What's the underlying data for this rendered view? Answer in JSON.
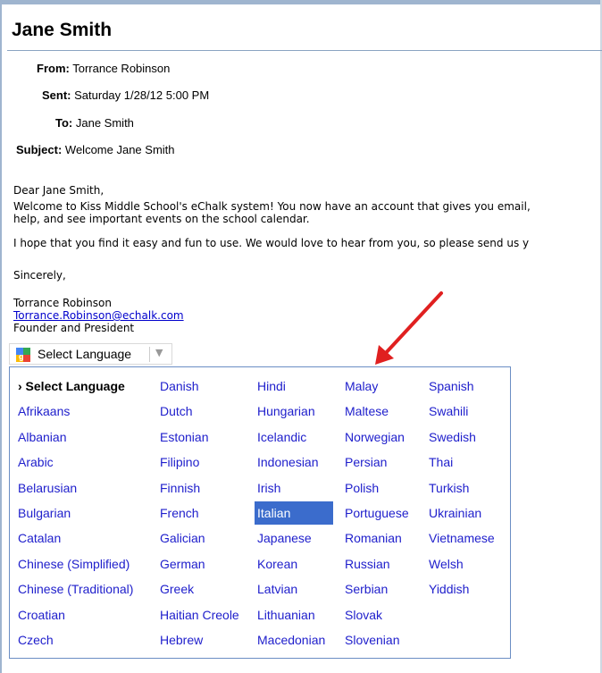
{
  "email": {
    "title": "Jane Smith",
    "from_label": "From:",
    "from_value": "Torrance Robinson",
    "sent_label": "Sent:",
    "sent_value": "Saturday 1/28/12 5:00 PM",
    "to_label": "To:",
    "to_value": "Jane Smith",
    "subject_label": "Subject:",
    "subject_value": "Welcome Jane Smith",
    "greeting": "Dear Jane Smith,",
    "para1_line1": "Welcome to Kiss Middle School's eChalk system! You now have an account that gives you email,",
    "para1_line2": "help, and see important events on the school calendar.",
    "para2": "I hope that you find it easy and fun to use. We would love to hear from you, so please send us y",
    "closing": "Sincerely,",
    "sig_name": "Torrance Robinson",
    "sig_email": "Torrance.Robinson@echalk.com",
    "sig_title": "Founder and President"
  },
  "translate": {
    "button_label": "Select Language",
    "arrow_glyph": "▼",
    "languages": [
      [
        "› Select Language",
        "Afrikaans",
        "Albanian",
        "Arabic",
        "Belarusian",
        "Bulgarian",
        "Catalan",
        "Chinese (Simplified)",
        "Chinese (Traditional)",
        "Croatian",
        "Czech"
      ],
      [
        "Danish",
        "Dutch",
        "Estonian",
        "Filipino",
        "Finnish",
        "French",
        "Galician",
        "German",
        "Greek",
        "Haitian Creole",
        "Hebrew"
      ],
      [
        "Hindi",
        "Hungarian",
        "Icelandic",
        "Indonesian",
        "Irish",
        "Italian",
        "Japanese",
        "Korean",
        "Latvian",
        "Lithuanian",
        "Macedonian"
      ],
      [
        "Malay",
        "Maltese",
        "Norwegian",
        "Persian",
        "Polish",
        "Portuguese",
        "Romanian",
        "Russian",
        "Serbian",
        "Slovak",
        "Slovenian"
      ],
      [
        "Spanish",
        "Swahili",
        "Swedish",
        "Thai",
        "Turkish",
        "Ukrainian",
        "Vietnamese",
        "Welsh",
        "Yiddish"
      ]
    ],
    "selected": "Italian"
  },
  "colors": {
    "link": "#2020cc",
    "selected_bg": "#3b6ccc",
    "annotation_arrow": "#e02020"
  }
}
